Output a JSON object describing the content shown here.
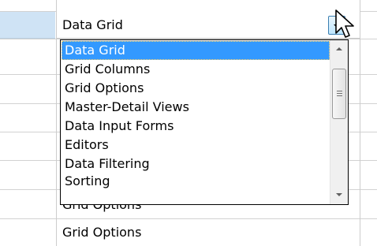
{
  "grid": {
    "rows": [
      {
        "text": ""
      },
      {
        "text": ""
      },
      {
        "text": ""
      },
      {
        "text": ""
      },
      {
        "text": ""
      },
      {
        "text": ""
      },
      {
        "text": "Grid Options"
      },
      {
        "text": "Grid Options"
      }
    ],
    "selection_color": "#cfe3f5"
  },
  "combo": {
    "value": "Data Grid",
    "button_icon": "chevron-down-icon"
  },
  "dropdown": {
    "items": [
      {
        "label": "Data Grid",
        "selected": true
      },
      {
        "label": "Grid Columns",
        "selected": false
      },
      {
        "label": "Grid Options",
        "selected": false
      },
      {
        "label": "Master-Detail Views",
        "selected": false
      },
      {
        "label": "Data Input Forms",
        "selected": false
      },
      {
        "label": "Editors",
        "selected": false
      },
      {
        "label": "Data Filtering",
        "selected": false
      },
      {
        "label": "Sorting",
        "selected": false
      }
    ],
    "highlight_color": "#3399ff",
    "scrollbar": {
      "up_icon": "scroll-up-arrow-icon",
      "down_icon": "scroll-down-arrow-icon",
      "thumb_icon": "grip-icon"
    }
  },
  "cursor_icon": "mouse-pointer-icon"
}
